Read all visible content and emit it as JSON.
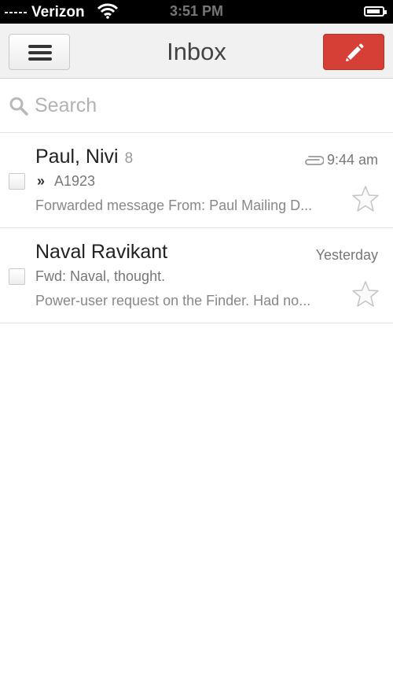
{
  "status_bar": {
    "carrier": "Verizon",
    "time": "3:51 PM"
  },
  "header": {
    "title": "Inbox",
    "menu_icon": "hamburger-menu-icon",
    "compose_icon": "pencil-icon",
    "compose_color": "#d63f35"
  },
  "search": {
    "placeholder": "Search",
    "value": ""
  },
  "messages": [
    {
      "sender": "Paul, Nivi",
      "count": "8",
      "time": "9:44 am",
      "has_attachment": true,
      "forwarded": true,
      "subject": "A1923",
      "snippet": "Forwarded message From: Paul Mailing D...",
      "starred": false
    },
    {
      "sender": "Naval Ravikant",
      "count": "",
      "time": "Yesterday",
      "has_attachment": false,
      "forwarded": false,
      "subject": "Fwd: Naval, thought.",
      "snippet": "Power-user request on the Finder. Had no...",
      "starred": false
    }
  ]
}
